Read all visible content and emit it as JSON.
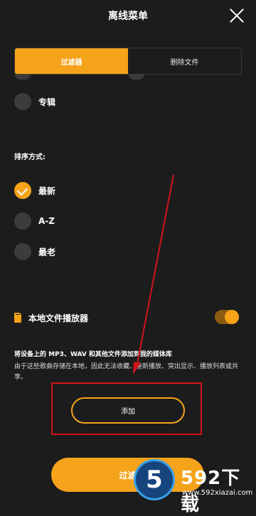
{
  "header": {
    "title": "离线菜单"
  },
  "tabs": [
    {
      "label": "过滤器",
      "active": true
    },
    {
      "label": "删除文件",
      "active": false
    }
  ],
  "filter": {
    "album_label": "专辑"
  },
  "sort": {
    "label": "排序方式:",
    "options": [
      {
        "label": "最新",
        "selected": true
      },
      {
        "label": "A-Z",
        "selected": false
      },
      {
        "label": "最老",
        "selected": false
      }
    ]
  },
  "local_player": {
    "label": "本地文件播放器",
    "enabled": true
  },
  "description": {
    "title": "将设备上的 MP3、WAV 和其他文件添加到我的媒体库",
    "body": "由于这些歌曲存储在本地，因此无法收藏、重新播放、突出显示、播放列表或共享。"
  },
  "add_button": {
    "label": "添加"
  },
  "bottom_button": {
    "label": "过滤"
  },
  "watermark": {
    "brand": "592下载",
    "glyph": "5",
    "url": "www.592xiazai.com"
  },
  "colors": {
    "accent": "#f5a31a",
    "background": "#1c1c1c",
    "highlight": "#d0141c"
  }
}
